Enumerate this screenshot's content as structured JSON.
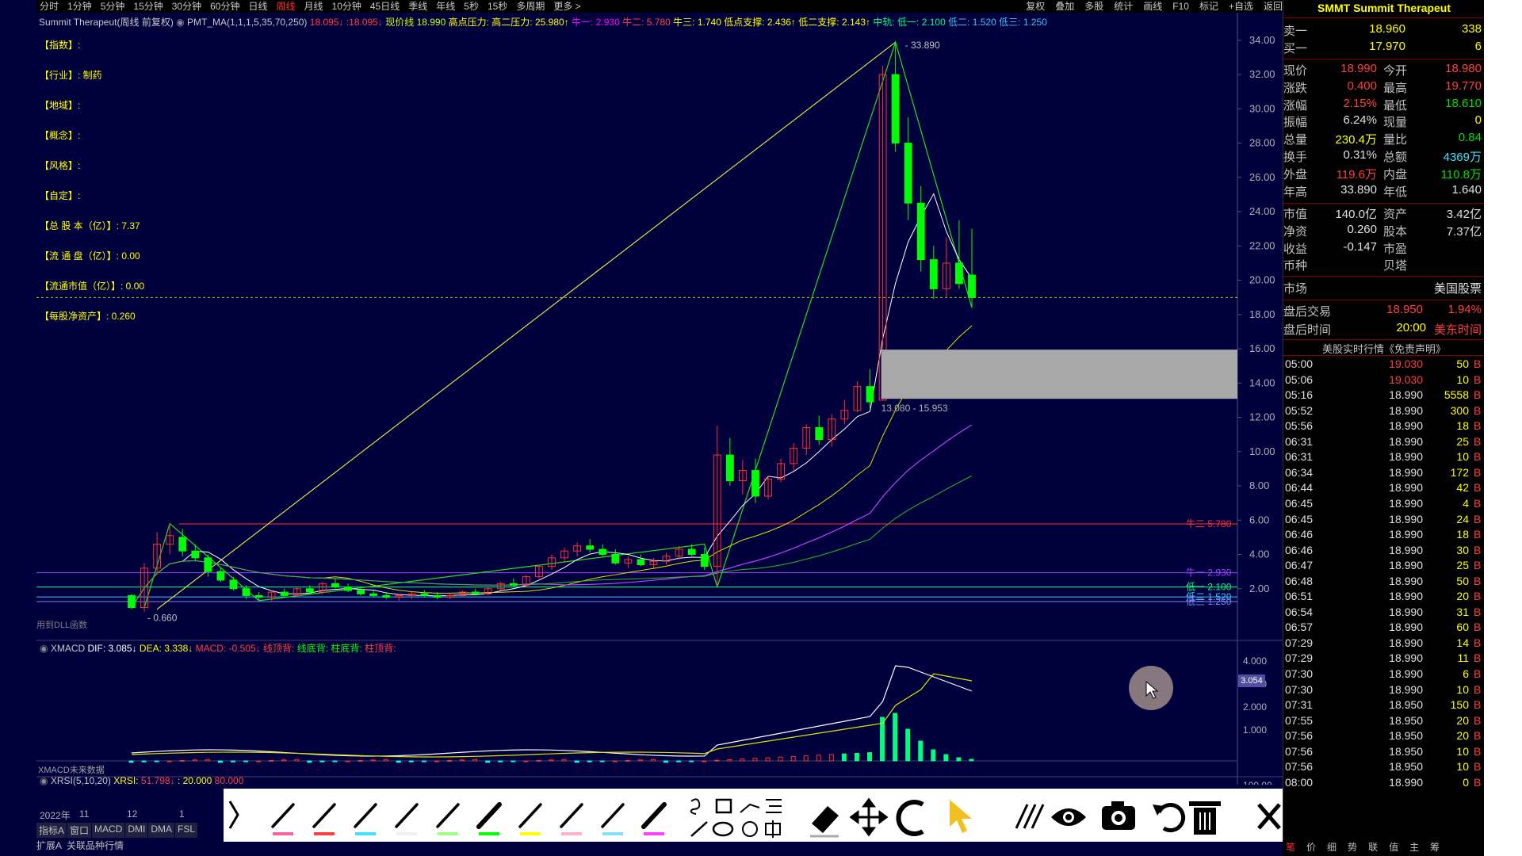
{
  "top_bar": {
    "timeframes": [
      "分时",
      "1分钟",
      "5分钟",
      "15分钟",
      "30分钟",
      "60分钟",
      "日线",
      "周线",
      "月线",
      "10分钟",
      "45日线",
      "季线",
      "年线",
      "5秒",
      "15秒",
      "多周期",
      "更多 >"
    ],
    "active_timeframe": "周线",
    "right_items": [
      "复权",
      "叠加",
      "多股",
      "统计",
      "画线",
      "F10",
      "标记",
      "+自选",
      "返回"
    ]
  },
  "chart_info": {
    "name": "Summit Therapeut(周线 前复权)",
    "indicator": "PMT_MA(1,1,1,5,35,70,250)",
    "v1": "18.095↓",
    "v2": ":18.095↓",
    "current_label": "现价线",
    "current_val": "18.990",
    "high_res_label": "高点压力:",
    "high_res2": "高二压力:",
    "high_res2_val": "25.980↑",
    "n1_label": "牛一:",
    "n1_val": "2.930",
    "n2_label": "牛二:",
    "n2_val": "5.780",
    "n3_label": "牛三:",
    "n3_val": "1.740",
    "low_sup_label": "低点支撑:",
    "low_sup_val": "2.436↑",
    "low2_sup_label": "低二支撑:",
    "low2_sup_val": "2.143↑",
    "mid_label": "中轨:",
    "low1_label": "低一:",
    "low1_val": "2.100",
    "low2_label": "低二:",
    "low2_val": "1.520",
    "low3_label": "低三:",
    "low3_val": "1.250"
  },
  "f10": [
    {
      "key": "【指数】",
      "val": ":"
    },
    {
      "key": "【行业】",
      "val": ": 制药"
    },
    {
      "key": "【地域】",
      "val": ":"
    },
    {
      "key": "【概念】",
      "val": ":"
    },
    {
      "key": "【风格】",
      "val": ":"
    },
    {
      "key": "【自定】",
      "val": ":"
    },
    {
      "key": "【总 股 本（亿）】",
      "val": ": 7.37"
    },
    {
      "key": "【流 通 盘（亿）】",
      "val": ": 0.00"
    },
    {
      "key": "【流通市值（亿）】",
      "val": ": 0.00"
    },
    {
      "key": "【每股净资产】",
      "val": ": 0.260"
    }
  ],
  "price_axis": [
    "34.00",
    "32.00",
    "30.00",
    "28.00",
    "26.00",
    "24.00",
    "22.00",
    "20.00",
    "18.00",
    "16.00",
    "14.00",
    "12.00",
    "10.00",
    "8.00",
    "6.00",
    "4.00",
    "2.00"
  ],
  "annotations": {
    "high": "33.890",
    "low": "0.660",
    "zone": "13.080 - 15.953",
    "n2_line": "牛二 5.780",
    "n1_line": "牛一 2.930",
    "low1_line": "低一 2.100",
    "low2_line": "低二 1.520",
    "low3_line": "低三 1.250",
    "dll_note": "用到DLL函数"
  },
  "chart_data": {
    "type": "candlestick",
    "title": "Summit Therapeut(周线 前复权)",
    "ylim": [
      0,
      34.5
    ],
    "candles": [
      [
        1.6,
        1.7,
        0.8,
        0.9
      ],
      [
        0.9,
        3.5,
        0.66,
        3.2
      ],
      [
        3.2,
        5.3,
        2.8,
        4.6
      ],
      [
        4.6,
        5.8,
        4.0,
        5.1
      ],
      [
        5.0,
        5.5,
        3.9,
        4.2
      ],
      [
        4.2,
        4.6,
        3.6,
        3.8
      ],
      [
        3.8,
        4.0,
        2.7,
        3.0
      ],
      [
        3.0,
        3.2,
        2.4,
        2.5
      ],
      [
        2.5,
        2.7,
        1.9,
        2.0
      ],
      [
        2.0,
        2.2,
        1.4,
        1.6
      ],
      [
        1.6,
        1.8,
        1.3,
        1.5
      ],
      [
        1.5,
        1.9,
        1.3,
        1.8
      ],
      [
        1.8,
        2.0,
        1.5,
        1.6
      ],
      [
        1.6,
        2.1,
        1.5,
        2.0
      ],
      [
        2.0,
        2.2,
        1.7,
        1.8
      ],
      [
        1.8,
        2.4,
        1.7,
        2.3
      ],
      [
        2.3,
        2.6,
        2.0,
        2.1
      ],
      [
        2.1,
        2.3,
        1.8,
        1.9
      ],
      [
        1.9,
        2.1,
        1.6,
        1.7
      ],
      [
        1.7,
        1.9,
        1.5,
        1.6
      ],
      [
        1.6,
        1.8,
        1.4,
        1.5
      ],
      [
        1.5,
        1.7,
        1.3,
        1.6
      ],
      [
        1.6,
        1.8,
        1.4,
        1.7
      ],
      [
        1.7,
        1.9,
        1.5,
        1.6
      ],
      [
        1.6,
        1.8,
        1.4,
        1.5
      ],
      [
        1.5,
        1.7,
        1.4,
        1.6
      ],
      [
        1.6,
        1.9,
        1.5,
        1.8
      ],
      [
        1.8,
        2.0,
        1.6,
        1.7
      ],
      [
        1.7,
        2.1,
        1.6,
        2.0
      ],
      [
        2.0,
        2.4,
        1.9,
        2.3
      ],
      [
        2.3,
        2.6,
        2.1,
        2.2
      ],
      [
        2.2,
        2.8,
        2.1,
        2.7
      ],
      [
        2.7,
        3.4,
        2.6,
        3.3
      ],
      [
        3.3,
        4.0,
        3.1,
        3.8
      ],
      [
        3.8,
        4.4,
        3.5,
        4.2
      ],
      [
        4.2,
        4.7,
        3.9,
        4.5
      ],
      [
        4.5,
        4.9,
        4.1,
        4.3
      ],
      [
        4.3,
        4.6,
        3.9,
        4.0
      ],
      [
        4.0,
        4.3,
        3.4,
        3.5
      ],
      [
        3.5,
        3.9,
        3.2,
        3.7
      ],
      [
        3.7,
        4.0,
        3.3,
        3.4
      ],
      [
        3.4,
        3.8,
        3.2,
        3.6
      ],
      [
        3.6,
        4.1,
        3.4,
        3.9
      ],
      [
        3.9,
        4.5,
        3.7,
        4.3
      ],
      [
        4.3,
        4.6,
        3.9,
        4.0
      ],
      [
        4.0,
        4.4,
        3.1,
        3.3
      ],
      [
        3.3,
        11.5,
        2.1,
        9.8
      ],
      [
        9.8,
        10.8,
        8.0,
        8.3
      ],
      [
        8.3,
        9.5,
        7.5,
        8.9
      ],
      [
        8.9,
        9.6,
        7.0,
        7.4
      ],
      [
        7.4,
        8.6,
        7.2,
        8.4
      ],
      [
        8.4,
        9.6,
        8.2,
        9.3
      ],
      [
        9.3,
        10.5,
        8.9,
        10.2
      ],
      [
        10.2,
        11.6,
        9.8,
        11.4
      ],
      [
        11.4,
        12.1,
        10.4,
        10.7
      ],
      [
        10.7,
        12.2,
        10.3,
        11.9
      ],
      [
        11.9,
        13.0,
        11.6,
        12.4
      ],
      [
        12.4,
        14.1,
        12.3,
        13.8
      ],
      [
        13.8,
        14.8,
        12.5,
        12.9
      ],
      [
        13.0,
        32.5,
        13.0,
        32.0
      ],
      [
        32.0,
        33.89,
        27.5,
        28.0
      ],
      [
        28.0,
        29.5,
        23.5,
        24.5
      ],
      [
        24.5,
        25.5,
        20.5,
        21.2
      ],
      [
        21.2,
        22.0,
        18.9,
        19.5
      ],
      [
        19.5,
        22.5,
        19.0,
        21.0
      ],
      [
        21.0,
        23.5,
        19.5,
        19.8
      ],
      [
        20.3,
        23.0,
        18.4,
        18.99
      ]
    ]
  },
  "macd": {
    "name": "XMACD",
    "dif_label": "DIF:",
    "dif": "3.085↓",
    "dea_label": "DEA:",
    "dea": "3.338↓",
    "macd_label": "MACD:",
    "macd_val": "-0.505↓",
    "signals": [
      "线顶背:",
      "线底背:",
      "柱底背:",
      "柱顶背:"
    ],
    "axis": [
      "4.000",
      "3.000",
      "2.000",
      "1.000"
    ],
    "badge": "3.054",
    "bottom_note": "XMACD未来数据"
  },
  "xrsi": {
    "name": "XRSI(5,10,20)",
    "label": "XRSI:",
    "val": "51.798↓",
    "v2": ": 20.000",
    "v3": "80.000",
    "axis_top": "100.00"
  },
  "xaxis_labels": [
    "2022年",
    "11",
    "12",
    "1"
  ],
  "bottom_tabs": [
    "指标A",
    "窗口",
    "MACD",
    "DMI",
    "DMA",
    "FSL"
  ],
  "bottom_tabs2": [
    "扩展A",
    "关联品种行情"
  ],
  "right_panel": {
    "title": "SMMT Summit Therapeut",
    "sell1_label": "卖一",
    "sell1_price": "18.960",
    "sell1_vol": "338",
    "buy1_label": "买一",
    "buy1_price": "17.970",
    "buy1_vol": "6",
    "quotes_left": [
      {
        "label": "现价",
        "val": "18.990",
        "cls": "up"
      },
      {
        "label": "涨跌",
        "val": "0.400",
        "cls": "up"
      },
      {
        "label": "涨幅",
        "val": "2.15%",
        "cls": "up"
      },
      {
        "label": "振幅",
        "val": "6.24%",
        "cls": "wh"
      },
      {
        "label": "总量",
        "val": "230.4万",
        "cls": "yl"
      },
      {
        "label": "换手",
        "val": "0.31%",
        "cls": "wh"
      },
      {
        "label": "外盘",
        "val": "119.6万",
        "cls": "up"
      },
      {
        "label": "年高",
        "val": "33.890",
        "cls": "wh"
      }
    ],
    "quotes_right": [
      {
        "label": "今开",
        "val": "18.980",
        "cls": "up"
      },
      {
        "label": "最高",
        "val": "19.770",
        "cls": "up"
      },
      {
        "label": "最低",
        "val": "18.610",
        "cls": "dn"
      },
      {
        "label": "现量",
        "val": "0",
        "cls": "yl"
      },
      {
        "label": "量比",
        "val": "0.84",
        "cls": "dn"
      },
      {
        "label": "总额",
        "val": "4369万",
        "cls": "cy"
      },
      {
        "label": "内盘",
        "val": "110.8万",
        "cls": "dn"
      },
      {
        "label": "年低",
        "val": "1.640",
        "cls": "wh"
      }
    ],
    "fin_left": [
      {
        "label": "市值",
        "val": "140.0亿"
      },
      {
        "label": "净资",
        "val": "0.260"
      },
      {
        "label": "收益",
        "val": "-0.147"
      },
      {
        "label": "币种",
        "val": ""
      }
    ],
    "fin_right": [
      {
        "label": "资产",
        "val": "3.42亿"
      },
      {
        "label": "股本",
        "val": "7.37亿"
      },
      {
        "label": "市盈",
        "val": ""
      },
      {
        "label": "贝塔",
        "val": ""
      }
    ],
    "market_label": "市场",
    "market_val": "美国股票",
    "after_label": "盘后交易",
    "after_price": "18.950",
    "after_pct": "1.94%",
    "after_time_label": "盘后时间",
    "after_time": "20:00",
    "after_tz": "美东时间",
    "disclaimer": "美股实时行情《免责声明》",
    "ticks": [
      [
        "05:00",
        "19.030",
        "50",
        "B"
      ],
      [
        "05:06",
        "19.030",
        "10",
        "B"
      ],
      [
        "05:16",
        "18.990",
        "5558",
        "B"
      ],
      [
        "05:52",
        "18.990",
        "300",
        "B"
      ],
      [
        "05:56",
        "18.990",
        "18",
        "B"
      ],
      [
        "06:31",
        "18.990",
        "25",
        "B"
      ],
      [
        "06:31",
        "18.990",
        "10",
        "B"
      ],
      [
        "06:34",
        "18.990",
        "172",
        "B"
      ],
      [
        "06:44",
        "18.990",
        "42",
        "B"
      ],
      [
        "06:45",
        "18.990",
        "4",
        "B"
      ],
      [
        "06:45",
        "18.990",
        "24",
        "B"
      ],
      [
        "06:46",
        "18.990",
        "18",
        "B"
      ],
      [
        "06:46",
        "18.990",
        "30",
        "B"
      ],
      [
        "06:47",
        "18.990",
        "25",
        "B"
      ],
      [
        "06:48",
        "18.990",
        "50",
        "B"
      ],
      [
        "06:51",
        "18.990",
        "20",
        "B"
      ],
      [
        "06:54",
        "18.990",
        "31",
        "B"
      ],
      [
        "06:57",
        "18.990",
        "60",
        "B"
      ],
      [
        "07:29",
        "18.990",
        "14",
        "B"
      ],
      [
        "07:29",
        "18.990",
        "11",
        "B"
      ],
      [
        "07:30",
        "18.990",
        "6",
        "B"
      ],
      [
        "07:30",
        "18.990",
        "10",
        "B"
      ],
      [
        "07:31",
        "18.950",
        "150",
        "B"
      ],
      [
        "07:55",
        "18.950",
        "20",
        "B"
      ],
      [
        "07:56",
        "18.950",
        "20",
        "B"
      ],
      [
        "07:56",
        "18.950",
        "10",
        "B"
      ],
      [
        "07:56",
        "18.950",
        "10",
        "B"
      ],
      [
        "08:00",
        "18.990",
        "0",
        "B"
      ]
    ],
    "bottom_tabs": [
      "笔",
      "价",
      "细",
      "势",
      "联",
      "值",
      "主",
      "筹"
    ]
  },
  "colors": {
    "bg": "#00003c",
    "up": "#ff3030",
    "down": "#00ff00",
    "panel": "#000000"
  }
}
